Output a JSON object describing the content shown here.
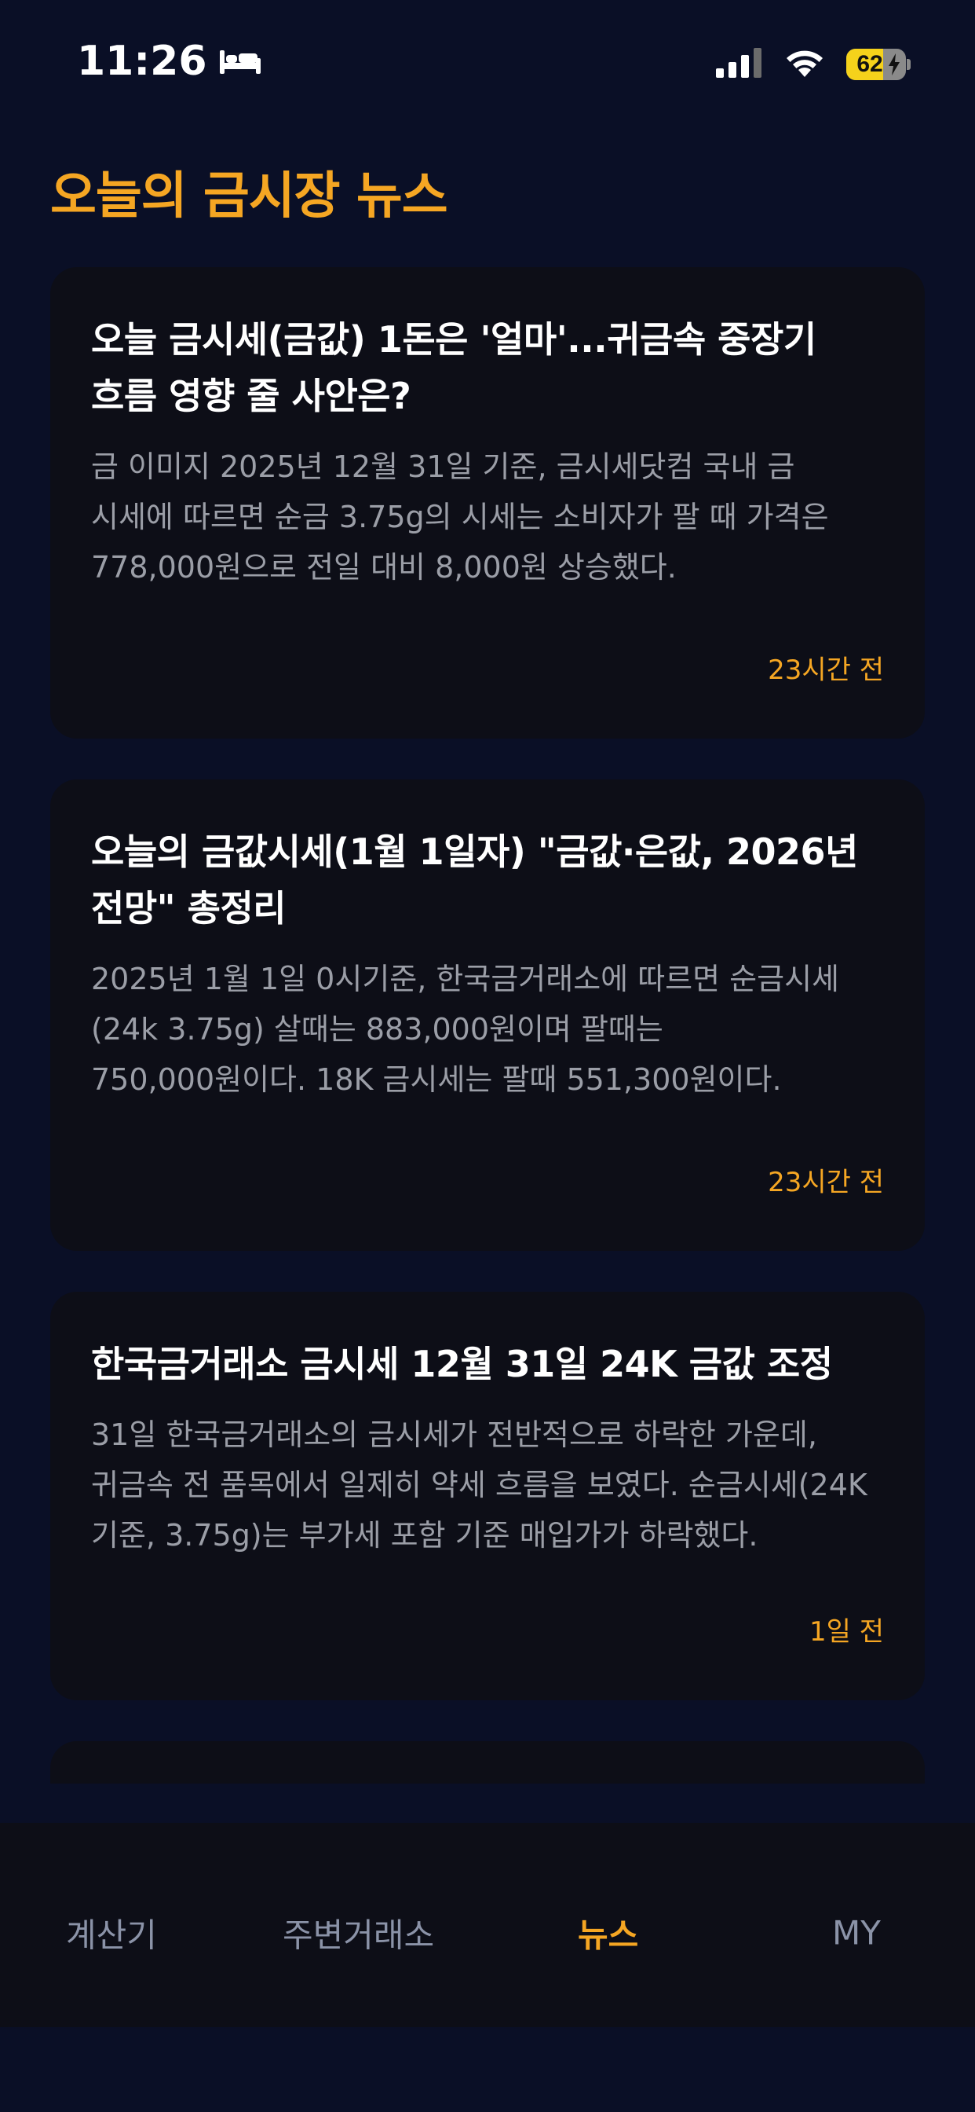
{
  "status_bar": {
    "time": "11:26",
    "battery": "62",
    "battery_level": 0.62
  },
  "header": {
    "title": "오늘의 금시장 뉴스"
  },
  "news": [
    {
      "title": "오늘 금시세(금값) 1돈은 '얼마'...귀금속 중장기 흐름 영향 줄 사안은?",
      "summary": "금 이미지 2025년 12월 31일 기준, 금시세닷컴 국내 금 시세에 따르면 순금 3.75g의 시세는 소비자가 팔 때 가격은 778,000원으로 전일 대비 8,000원 상승했다.",
      "time": "23시간 전"
    },
    {
      "title": "오늘의 금값시세(1월 1일자) \"금값·은값, 2026년 전망\" 총정리",
      "summary": "2025년 1월 1일 0시기준, 한국금거래소에 따르면 순금시세(24k 3.75g) 살때는 883,000원이며 팔때는 750,000원이다. 18K 금시세는 팔때 551,300원이다.",
      "time": "23시간 전"
    },
    {
      "title": "한국금거래소 금시세 12월 31일 24K 금값 조정",
      "summary": "31일 한국금거래소의 금시세가 전반적으로 하락한 가운데, 귀금속 전 품목에서 일제히 약세 흐름을 보였다. 순금시세(24K 기준, 3.75g)는 부가세 포함 기준 매입가가 하락했다.",
      "time": "1일 전"
    }
  ],
  "tabs": [
    {
      "label": "계산기",
      "active": false
    },
    {
      "label": "주변거래소",
      "active": false
    },
    {
      "label": "뉴스",
      "active": true
    },
    {
      "label": "MY",
      "active": false
    }
  ]
}
